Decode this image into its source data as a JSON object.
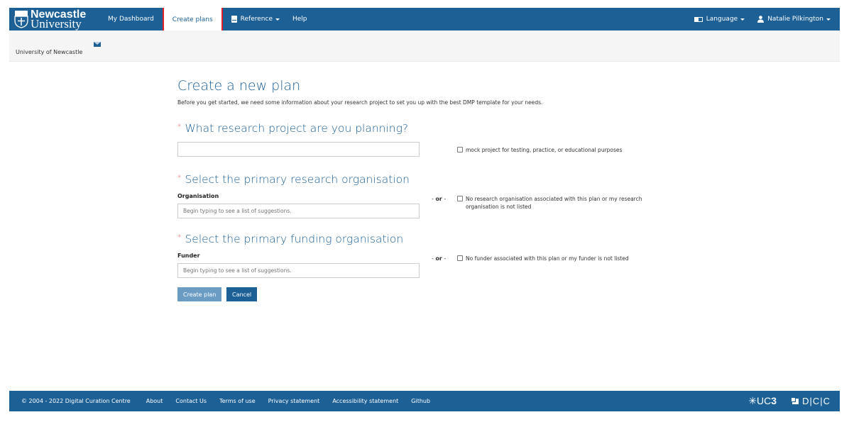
{
  "navbar": {
    "logo_line1": "Newcastle",
    "logo_line2": "University",
    "items": [
      {
        "label": "My Dashboard",
        "active": false
      },
      {
        "label": "Create plans",
        "active": true
      },
      {
        "label": "Reference",
        "active": false,
        "dropdown": true,
        "icon": "book-icon"
      },
      {
        "label": "Help",
        "active": false
      }
    ],
    "language_label": "Language",
    "language_icon": "language-icon",
    "user_label": "Natalie Pilkington",
    "user_icon": "user-icon"
  },
  "subbar": {
    "org_name": "University of Newcastle",
    "icon": "envelope-icon"
  },
  "main": {
    "title": "Create a new plan",
    "intro": "Before you get started, we need some information about your research project to set you up with the best DMP template for your needs.",
    "required_marker": "*",
    "project": {
      "heading": "What research project are you planning?",
      "value": "",
      "mock_checkbox_label": "mock project for testing, practice, or educational purposes",
      "mock_checked": false
    },
    "research_org": {
      "heading": "Select the primary research organisation",
      "label": "Organisation",
      "placeholder": "Begin typing to see a list of suggestions.",
      "or_prefix": "- ",
      "or_word": "or",
      "or_suffix": " -",
      "checkbox_label": "No research organisation associated with this plan or my research organisation is not listed",
      "checked": false
    },
    "funder": {
      "heading": "Select the primary funding organisation",
      "label": "Funder",
      "placeholder": "Begin typing to see a list of suggestions.",
      "or_prefix": "- ",
      "or_word": "or",
      "or_suffix": " -",
      "checkbox_label": "No funder associated with this plan or my funder is not listed",
      "checked": false
    },
    "create_button": "Create plan",
    "cancel_button": "Cancel"
  },
  "footer": {
    "copyright": "© 2004 - 2022 Digital Curation Centre",
    "links": [
      "About",
      "Contact Us",
      "Terms of use",
      "Privacy statement",
      "Accessibility statement",
      "Github"
    ],
    "uc3_logo": "UC",
    "uc3_num": "3",
    "dcc_logo": "D|C|C"
  },
  "colors": {
    "brand": "#1c6096",
    "highlight": "#e32029",
    "required": "#e35b5b",
    "button_disabled": "#6a9cc4"
  }
}
